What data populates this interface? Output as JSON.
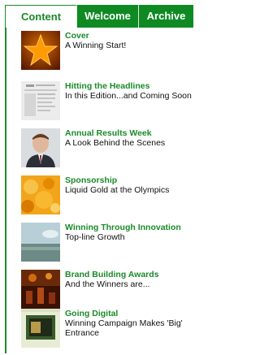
{
  "tabs": {
    "content": "Content",
    "welcome": "Welcome",
    "archive": "Archive"
  },
  "items": [
    {
      "title": "Cover",
      "desc": "A Winning Start!"
    },
    {
      "title": "Hitting the Headlines",
      "desc": "In this Edition...and Coming Soon"
    },
    {
      "title": "Annual Results Week",
      "desc": "A Look Behind the Scenes"
    },
    {
      "title": "Sponsorship",
      "desc": "Liquid Gold at the Olympics"
    },
    {
      "title": "Winning Through Innovation",
      "desc": "Top-line Growth"
    },
    {
      "title": "Brand Building Awards",
      "desc": "And the Winners are..."
    },
    {
      "title": "Going Digital",
      "desc": "Winning Campaign Makes 'Big' Entrance"
    }
  ],
  "colors": {
    "accent": "#1a8a2a",
    "tab_bg": "#0f8a23"
  }
}
